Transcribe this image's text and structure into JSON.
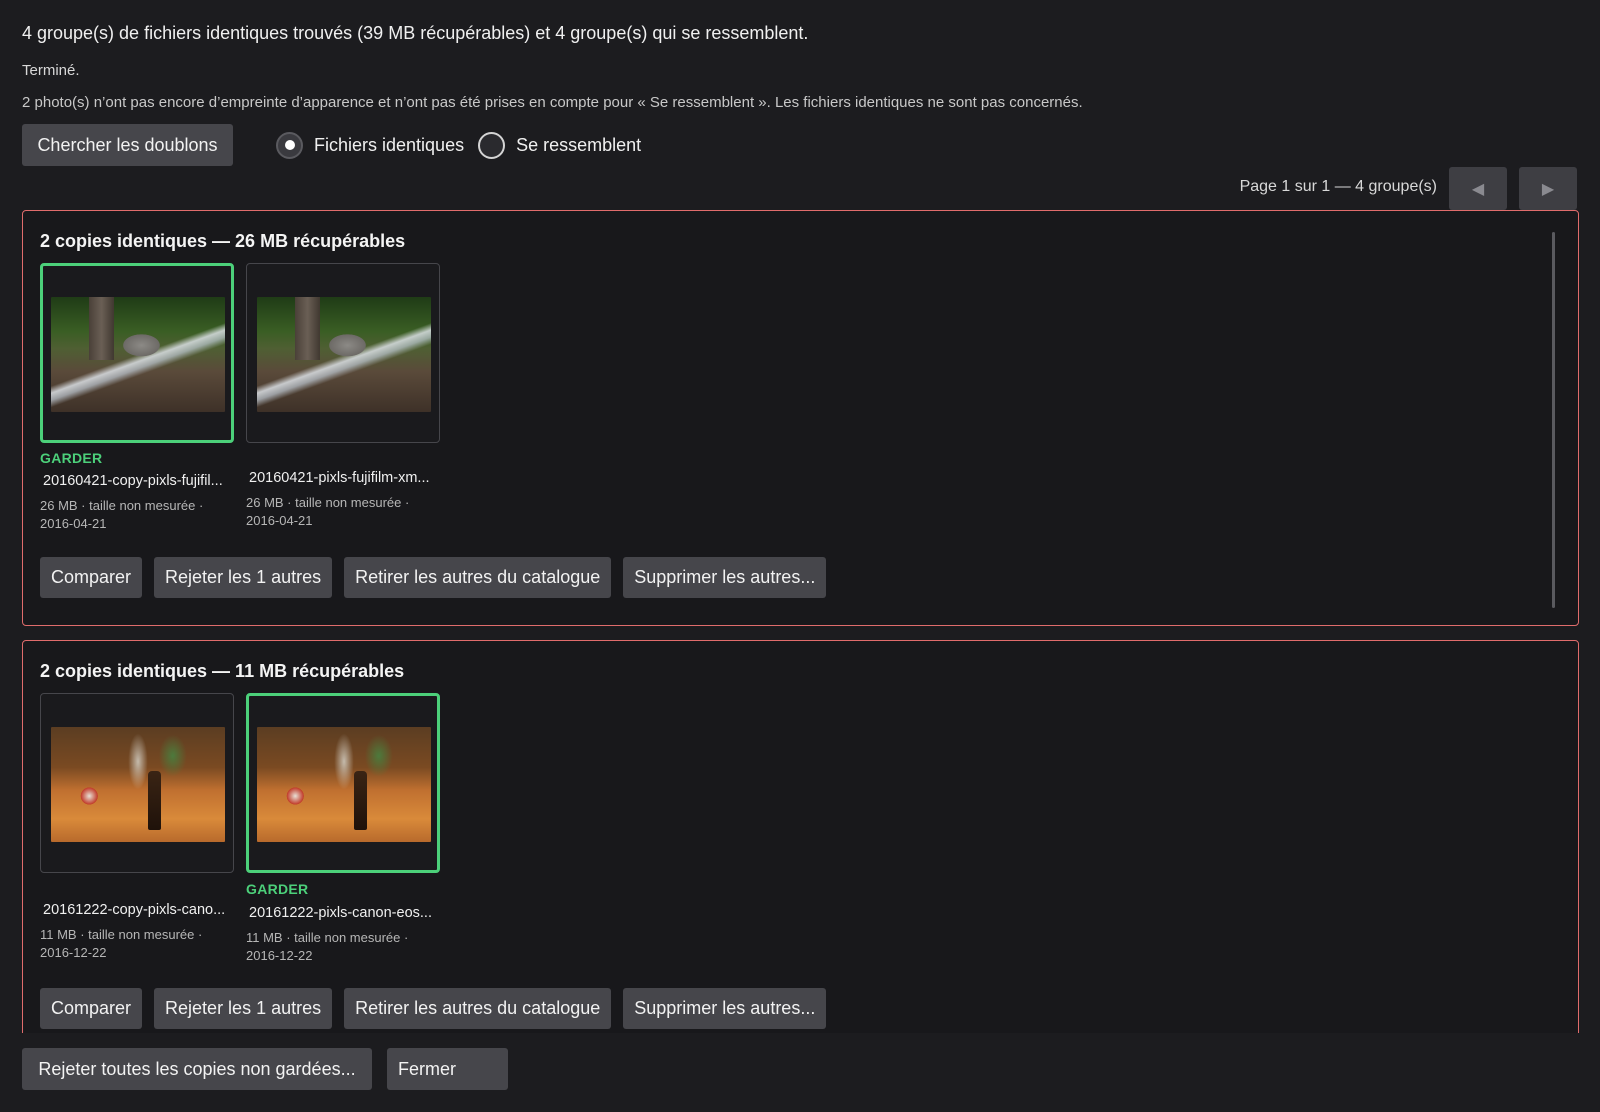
{
  "header": {
    "summary": "4 groupe(s) de fichiers identiques trouvés (39 MB récupérables) et 4 groupe(s) qui se ressemblent.",
    "status": "Terminé.",
    "note": "2 photo(s) n’ont pas encore d’empreinte d’apparence et n’ont pas été prises en compte pour « Se ressemblent ». Les fichiers identiques ne sont pas concernés."
  },
  "toolbar": {
    "search_label": "Chercher les doublons",
    "mode_identical": "Fichiers identiques",
    "mode_similar": "Se ressemblent",
    "selected_mode": "identical"
  },
  "pager": {
    "text": "Page 1 sur 1 — 4 groupe(s)",
    "prev_icon": "◀",
    "next_icon": "▶"
  },
  "groups": [
    {
      "title": "2 copies identiques — 26 MB récupérables",
      "files": [
        {
          "kept": true,
          "keep_label": "GARDER",
          "name": "20160421-copy-pixls-fujifil...",
          "meta_line1": "26 MB · taille non mesurée ·",
          "meta_line2": "2016-04-21",
          "thumbnail": "forest-waterfall"
        },
        {
          "kept": false,
          "name": "20160421-pixls-fujifilm-xm...",
          "meta_line1": "26 MB · taille non mesurée ·",
          "meta_line2": "2016-04-21",
          "thumbnail": "forest-waterfall"
        }
      ],
      "actions": {
        "compare": "Comparer",
        "reject": "Rejeter les 1 autres",
        "remove": "Retirer les autres du catalogue",
        "delete": "Supprimer les autres..."
      }
    },
    {
      "title": "2 copies identiques — 11 MB récupérables",
      "files": [
        {
          "kept": false,
          "name": "20161222-copy-pixls-cano...",
          "meta_line1": "11 MB · taille non mesurée ·",
          "meta_line2": "2016-12-22",
          "thumbnail": "table-bottles"
        },
        {
          "kept": true,
          "keep_label": "GARDER",
          "name": "20161222-pixls-canon-eos...",
          "meta_line1": "11 MB · taille non mesurée ·",
          "meta_line2": "2016-12-22",
          "thumbnail": "table-bottles"
        }
      ],
      "actions": {
        "compare": "Comparer",
        "reject": "Rejeter les 1 autres",
        "remove": "Retirer les autres du catalogue",
        "delete": "Supprimer les autres..."
      }
    }
  ],
  "footer": {
    "reject_all": "Rejeter toutes les copies non gardées...",
    "close": "Fermer"
  },
  "colors": {
    "group_border": "#e06c6c",
    "keep_accent": "#4cd07a",
    "background": "#1c1c1f",
    "button": "#46464b"
  }
}
